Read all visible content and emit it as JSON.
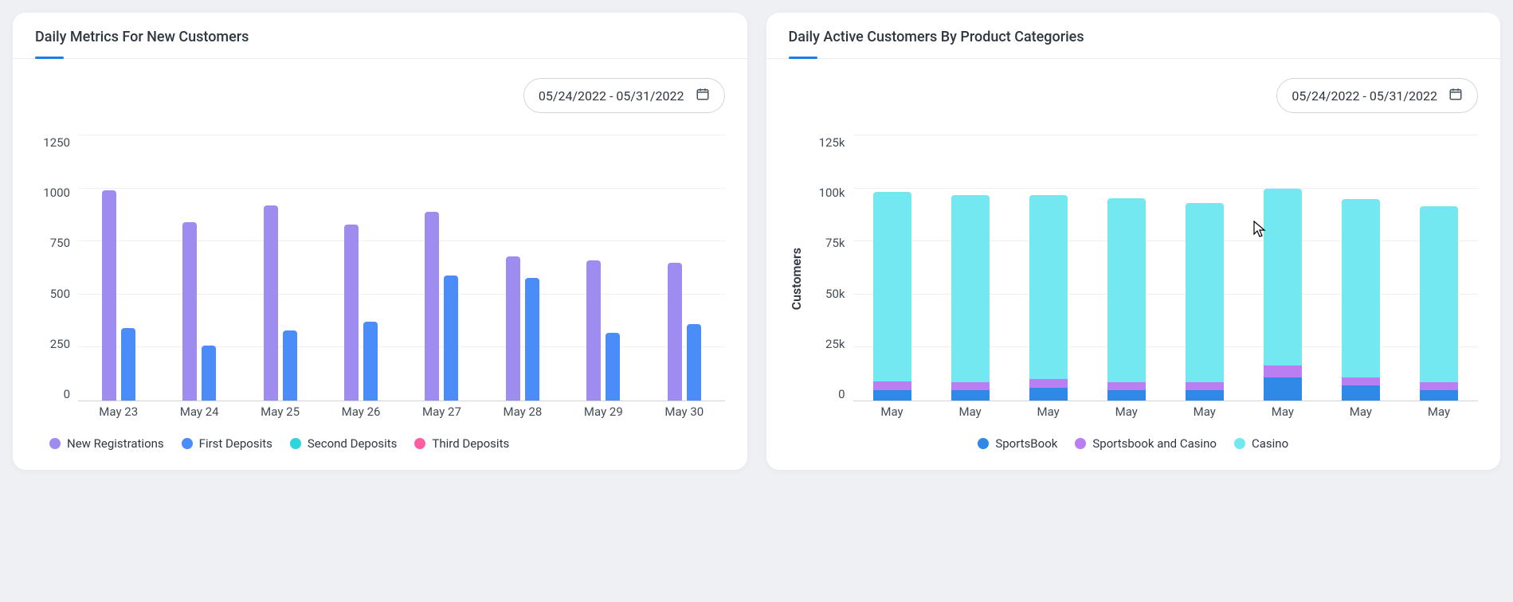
{
  "left_card": {
    "title": "Daily Metrics For New Customers",
    "date_range": "05/24/2022 - 05/31/2022",
    "legend": [
      {
        "label": "New Registrations",
        "color": "#9e8cf0"
      },
      {
        "label": "First Deposits",
        "color": "#4a8df8"
      },
      {
        "label": "Second Deposits",
        "color": "#2fd5dd"
      },
      {
        "label": "Third Deposits",
        "color": "#ff5fa2"
      }
    ]
  },
  "right_card": {
    "title": "Daily Active Customers By Product Categories",
    "date_range": "05/24/2022 - 05/31/2022",
    "y_title": "Customers",
    "legend": [
      {
        "label": "SportsBook",
        "color": "#2e8ae6"
      },
      {
        "label": "Sportsbook and Casino",
        "color": "#bb7df2"
      },
      {
        "label": "Casino",
        "color": "#73e8f0"
      }
    ]
  },
  "chart_data": [
    {
      "type": "bar",
      "title": "Daily Metrics For New Customers",
      "categories": [
        "May 23",
        "May 24",
        "May 25",
        "May 26",
        "May 27",
        "May 28",
        "May 29",
        "May 30"
      ],
      "series": [
        {
          "name": "New Registrations",
          "color": "#9e8cf0",
          "values": [
            990,
            840,
            920,
            830,
            890,
            680,
            660,
            650
          ]
        },
        {
          "name": "First Deposits",
          "color": "#4a8df8",
          "values": [
            340,
            260,
            330,
            370,
            590,
            580,
            320,
            360
          ]
        },
        {
          "name": "Second Deposits",
          "color": "#2fd5dd",
          "values": [
            0,
            0,
            0,
            0,
            0,
            0,
            0,
            0
          ]
        },
        {
          "name": "Third Deposits",
          "color": "#ff5fa2",
          "values": [
            0,
            0,
            0,
            0,
            0,
            0,
            0,
            0
          ]
        }
      ],
      "ylabel": "",
      "xlabel": "",
      "ylim": [
        0,
        1250
      ],
      "y_ticks": [
        0,
        250,
        500,
        750,
        1000,
        1250
      ]
    },
    {
      "type": "bar",
      "stacked": true,
      "title": "Daily Active Customers By Product Categories",
      "categories": [
        "May",
        "May",
        "May",
        "May",
        "May",
        "May",
        "May",
        "May"
      ],
      "series": [
        {
          "name": "SportsBook",
          "color": "#2e8ae6",
          "values": [
            5000,
            5000,
            6000,
            5000,
            5000,
            11000,
            7000,
            5000
          ]
        },
        {
          "name": "Sportsbook and Casino",
          "color": "#bb7df2",
          "values": [
            4000,
            3500,
            4000,
            3500,
            3500,
            5500,
            4000,
            3500
          ]
        },
        {
          "name": "Casino",
          "color": "#73e8f0",
          "values": [
            89500,
            88500,
            87000,
            87000,
            84500,
            83500,
            84000,
            83000
          ]
        }
      ],
      "ylabel": "Customers",
      "xlabel": "",
      "ylim": [
        0,
        125000
      ],
      "y_ticks": [
        "0",
        "25k",
        "50k",
        "75k",
        "100k",
        "125k"
      ]
    }
  ]
}
